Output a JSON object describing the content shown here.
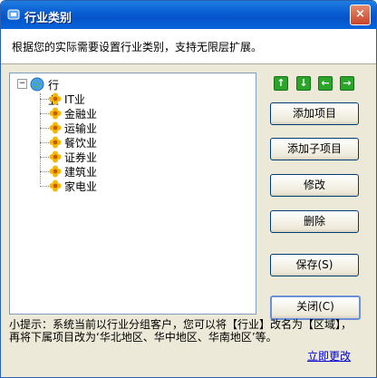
{
  "window": {
    "title": "行业类别",
    "close_glyph": "×"
  },
  "header": {
    "description": "根据您的实际需要设置行业类别，支持无限层扩展。"
  },
  "tree": {
    "root": {
      "label": "行业",
      "expander": "−",
      "icon": "globe-icon"
    },
    "items": [
      {
        "label": "IT业",
        "icon": "flower-icon"
      },
      {
        "label": "金融业",
        "icon": "flower-icon"
      },
      {
        "label": "运输业",
        "icon": "flower-icon"
      },
      {
        "label": "餐饮业",
        "icon": "flower-icon"
      },
      {
        "label": "证券业",
        "icon": "flower-icon"
      },
      {
        "label": "建筑业",
        "icon": "flower-icon"
      },
      {
        "label": "家电业",
        "icon": "flower-icon"
      }
    ]
  },
  "arrows": [
    {
      "name": "move-up",
      "glyph": "↑"
    },
    {
      "name": "move-down",
      "glyph": "↓"
    },
    {
      "name": "move-left",
      "glyph": "←"
    },
    {
      "name": "move-right",
      "glyph": "→"
    }
  ],
  "buttons": {
    "add_item": "添加项目",
    "add_child": "添加子项目",
    "edit": "修改",
    "delete": "删除",
    "save": "保存(S)",
    "close": "关闭(C)"
  },
  "tip": {
    "line1": "小提示：系统当前以行业分组客户，您可以将【行业】改名为【区域】，",
    "line2": "再将下属项目改为‘华北地区、华中地区、华南地区’等。",
    "link": "立即更改"
  },
  "colors": {
    "titlebar": "#0a5fd3",
    "window_bg": "#ece9d8",
    "arrow_green": "#2aa52a",
    "link": "#0000cc"
  }
}
